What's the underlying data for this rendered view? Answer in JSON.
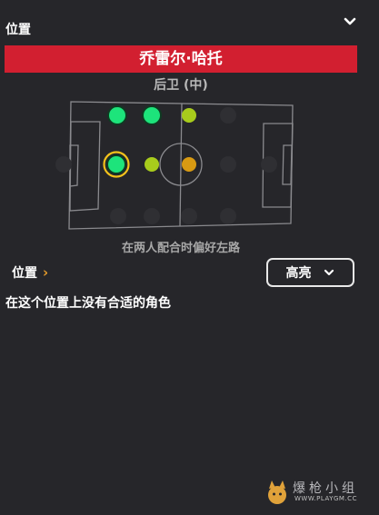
{
  "header": {
    "title": "位置",
    "collapse_icon": "chevron-down-icon"
  },
  "player": {
    "name": "乔雷尔·哈托",
    "role": "后卫 (中)"
  },
  "pitch": {
    "colors": {
      "best": "#1de47b",
      "good": "#a8cc1c",
      "ok": "#d89a12",
      "selected_ring": "#f2c21b",
      "lines": "#8a8a8e",
      "empty": "#2f2f33"
    },
    "positions": [
      {
        "id": "gk",
        "rating": "empty"
      },
      {
        "id": "dl",
        "rating": "best"
      },
      {
        "id": "dc",
        "rating": "best",
        "selected": true
      },
      {
        "id": "dr",
        "rating": "empty"
      },
      {
        "id": "wbl",
        "rating": "best"
      },
      {
        "id": "dm",
        "rating": "good"
      },
      {
        "id": "wbr",
        "rating": "empty"
      },
      {
        "id": "ml",
        "rating": "good"
      },
      {
        "id": "mc",
        "rating": "ok"
      },
      {
        "id": "mr",
        "rating": "empty"
      },
      {
        "id": "aml",
        "rating": "empty"
      },
      {
        "id": "amc",
        "rating": "empty"
      },
      {
        "id": "amr",
        "rating": "empty"
      },
      {
        "id": "st",
        "rating": "empty"
      }
    ]
  },
  "preference_note": "在两人配合时偏好左路",
  "position_link": {
    "label": "位置",
    "icon": "chevron-right-icon"
  },
  "highlight": {
    "selected": "高亮",
    "icon": "chevron-down-icon"
  },
  "empty_message": "在这个位置上没有合适的角色",
  "watermark": {
    "text": "爆枪小组",
    "url": "WWW.PLAYGM.CC",
    "logo": "wolf-logo"
  }
}
